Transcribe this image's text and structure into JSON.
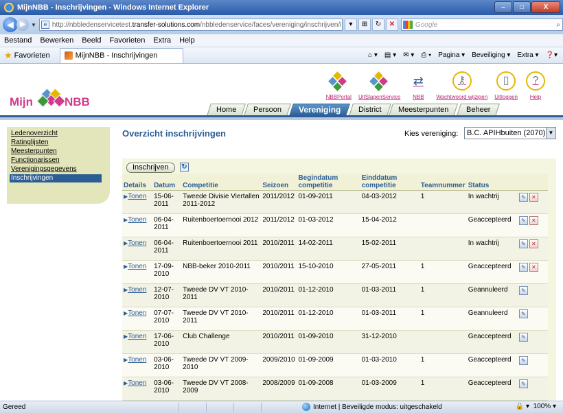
{
  "window": {
    "title": "MijnNBB - Inschrijvingen - Windows Internet Explorer",
    "minimize": "–",
    "maximize": "□",
    "close": "X"
  },
  "address": {
    "url_prefix": "http://nbbledenservicetest.",
    "url_host": "transfer-solutions.com",
    "url_path": "/nbbledenservice/faces/vereniging/inschrijven/i",
    "search_placeholder": "Google"
  },
  "menu": [
    "Bestand",
    "Bewerken",
    "Beeld",
    "Favorieten",
    "Extra",
    "Help"
  ],
  "favbar": {
    "favorites": "Favorieten",
    "tab_title": "MijnNBB - Inschrijvingen",
    "commands": [
      "Pagina ▾",
      "Beveiliging ▾",
      "Extra ▾"
    ]
  },
  "logo": {
    "left": "Mijn",
    "right": "NBB"
  },
  "tools": [
    {
      "label": "NBBPortal"
    },
    {
      "label": "UitSlagenService"
    },
    {
      "label": "NBB"
    },
    {
      "label": "Wachtwoord wijzigen"
    },
    {
      "label": "Uitloggen"
    },
    {
      "label": "Help"
    }
  ],
  "tabs": [
    {
      "label": "Home",
      "active": false
    },
    {
      "label": "Persoon",
      "active": false
    },
    {
      "label": "Vereniging",
      "active": true
    },
    {
      "label": "District",
      "active": false
    },
    {
      "label": "Meesterpunten",
      "active": false
    },
    {
      "label": "Beheer",
      "active": false
    }
  ],
  "sidebar": [
    {
      "label": "Ledenoverzicht",
      "active": false
    },
    {
      "label": "Ratinglijsten",
      "active": false
    },
    {
      "label": "Meesterpunten",
      "active": false
    },
    {
      "label": "Functionarissen",
      "active": false
    },
    {
      "label": "Verenigingsgegevens",
      "active": false
    },
    {
      "label": "Inschrijvingen",
      "active": true
    }
  ],
  "content": {
    "title": "Overzicht inschrijvingen",
    "kies_label": "Kies vereniging:",
    "kies_value": "B.C. APIHbuiten (2070)",
    "button_inschrijven": "Inschrijven"
  },
  "table": {
    "columns": [
      "Details",
      "Datum",
      "Competitie",
      "Seizoen",
      "Begindatum competitie",
      "Einddatum competitie",
      "Teamnummer",
      "Status"
    ],
    "link_label": "Tonen",
    "rows": [
      {
        "datum": "15-06-2011",
        "competitie": "Tweede Divisie Viertallen 2011-2012",
        "seizoen": "2011/2012",
        "begin": "01-09-2011",
        "eind": "04-03-2012",
        "team": "1",
        "status": "In wachtrij",
        "delete": true
      },
      {
        "datum": "06-04-2011",
        "competitie": "Ruitenboertoernooi 2012",
        "seizoen": "2011/2012",
        "begin": "01-03-2012",
        "eind": "15-04-2012",
        "team": "",
        "status": "Geaccepteerd",
        "delete": true
      },
      {
        "datum": "06-04-2011",
        "competitie": "Ruitenboertoernooi 2011",
        "seizoen": "2010/2011",
        "begin": "14-02-2011",
        "eind": "15-02-2011",
        "team": "",
        "status": "In wachtrij",
        "delete": true
      },
      {
        "datum": "17-09-2010",
        "competitie": "NBB-beker 2010-2011",
        "seizoen": "2010/2011",
        "begin": "15-10-2010",
        "eind": "27-05-2011",
        "team": "1",
        "status": "Geaccepteerd",
        "delete": true
      },
      {
        "datum": "12-07-2010",
        "competitie": "Tweede DV VT 2010-2011",
        "seizoen": "2010/2011",
        "begin": "01-12-2010",
        "eind": "01-03-2011",
        "team": "1",
        "status": "Geannuleerd",
        "delete": false
      },
      {
        "datum": "07-07-2010",
        "competitie": "Tweede DV VT 2010-2011",
        "seizoen": "2010/2011",
        "begin": "01-12-2010",
        "eind": "01-03-2011",
        "team": "1",
        "status": "Geannuleerd",
        "delete": false
      },
      {
        "datum": "17-06-2010",
        "competitie": "Club Challenge",
        "seizoen": "2010/2011",
        "begin": "01-09-2010",
        "eind": "31-12-2010",
        "team": "",
        "status": "Geaccepteerd",
        "delete": false
      },
      {
        "datum": "03-06-2010",
        "competitie": "Tweede DV VT 2009-2010",
        "seizoen": "2009/2010",
        "begin": "01-09-2009",
        "eind": "01-03-2010",
        "team": "1",
        "status": "Geaccepteerd",
        "delete": false
      },
      {
        "datum": "03-06-2010",
        "competitie": "Tweede DV VT 2008-2009",
        "seizoen": "2008/2009",
        "begin": "01-09-2008",
        "eind": "01-03-2009",
        "team": "1",
        "status": "Geaccepteerd",
        "delete": false
      },
      {
        "datum": "03-06-2010",
        "competitie": "Tweede DV VT 2007-2008",
        "seizoen": "2007/2008",
        "begin": "01-09-2007",
        "eind": "01-03-2008",
        "team": "1",
        "status": "Geaccepteerd",
        "delete": false
      }
    ]
  },
  "status": {
    "left": "Gereed",
    "zone": "Internet | Beveiligde modus: uitgeschakeld",
    "zoom": "100%"
  },
  "colors": {
    "brand_blue": "#2c5e95",
    "brand_pink": "#d13a8a",
    "sidebar_bg": "#e3e6ba"
  }
}
